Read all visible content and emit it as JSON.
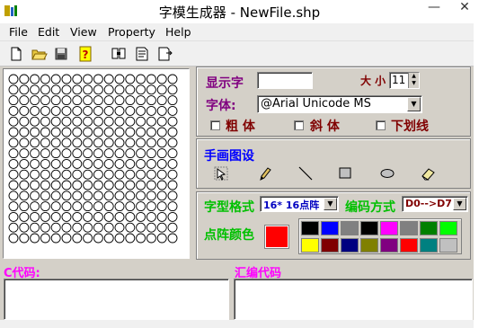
{
  "window": {
    "title": "字模生成器 - NewFile.shp",
    "minimize_glyph": "—",
    "close_glyph": "✕"
  },
  "menu": [
    "File",
    "Edit",
    "View",
    "Property",
    "Help"
  ],
  "toolbar_icons": [
    "new-file-icon",
    "open-folder-icon",
    "save-icon",
    "help-icon",
    "find-icon",
    "generate-icon",
    "export-icon"
  ],
  "display": {
    "char_label": "显示字",
    "char_value": "",
    "size_label": "大 小",
    "size_value": "11",
    "font_label": "字体:",
    "font_value": "@Arial Unicode MS",
    "bold_label": "粗 体",
    "italic_label": "斜 体",
    "underline_label": "下划线",
    "bold_checked": false,
    "italic_checked": false,
    "underline_checked": false
  },
  "draw": {
    "title": "手画图设",
    "tools": [
      "select-tool-icon",
      "pencil-tool-icon",
      "line-tool-icon",
      "rectangle-tool-icon",
      "ellipse-tool-icon",
      "eraser-tool-icon"
    ]
  },
  "format": {
    "matrix_label": "字型格式",
    "matrix_value": "16* 16点阵",
    "encoding_label": "编码方式",
    "encoding_value": "D0-->D7",
    "color_label": "点阵颜色",
    "current_color": "#ff0000",
    "palette_row1": [
      "#000000",
      "#0000ff",
      "#808080",
      "#000000",
      "#ff00ff",
      "#808080",
      "#008000",
      "#00ff00"
    ],
    "palette_row2": [
      "#ffff00",
      "#800000",
      "#000080",
      "#808000",
      "#800080",
      "#ff0000",
      "#008080",
      "#c0c0c0"
    ]
  },
  "code": {
    "c_label": "C代码:",
    "c_value": "",
    "asm_label": "汇编代码",
    "asm_value": ""
  },
  "colors": {
    "purple": "#800080",
    "dark_red": "#800000",
    "blue": "#0000ff",
    "green": "#00c000",
    "magenta": "#ff00ff"
  }
}
